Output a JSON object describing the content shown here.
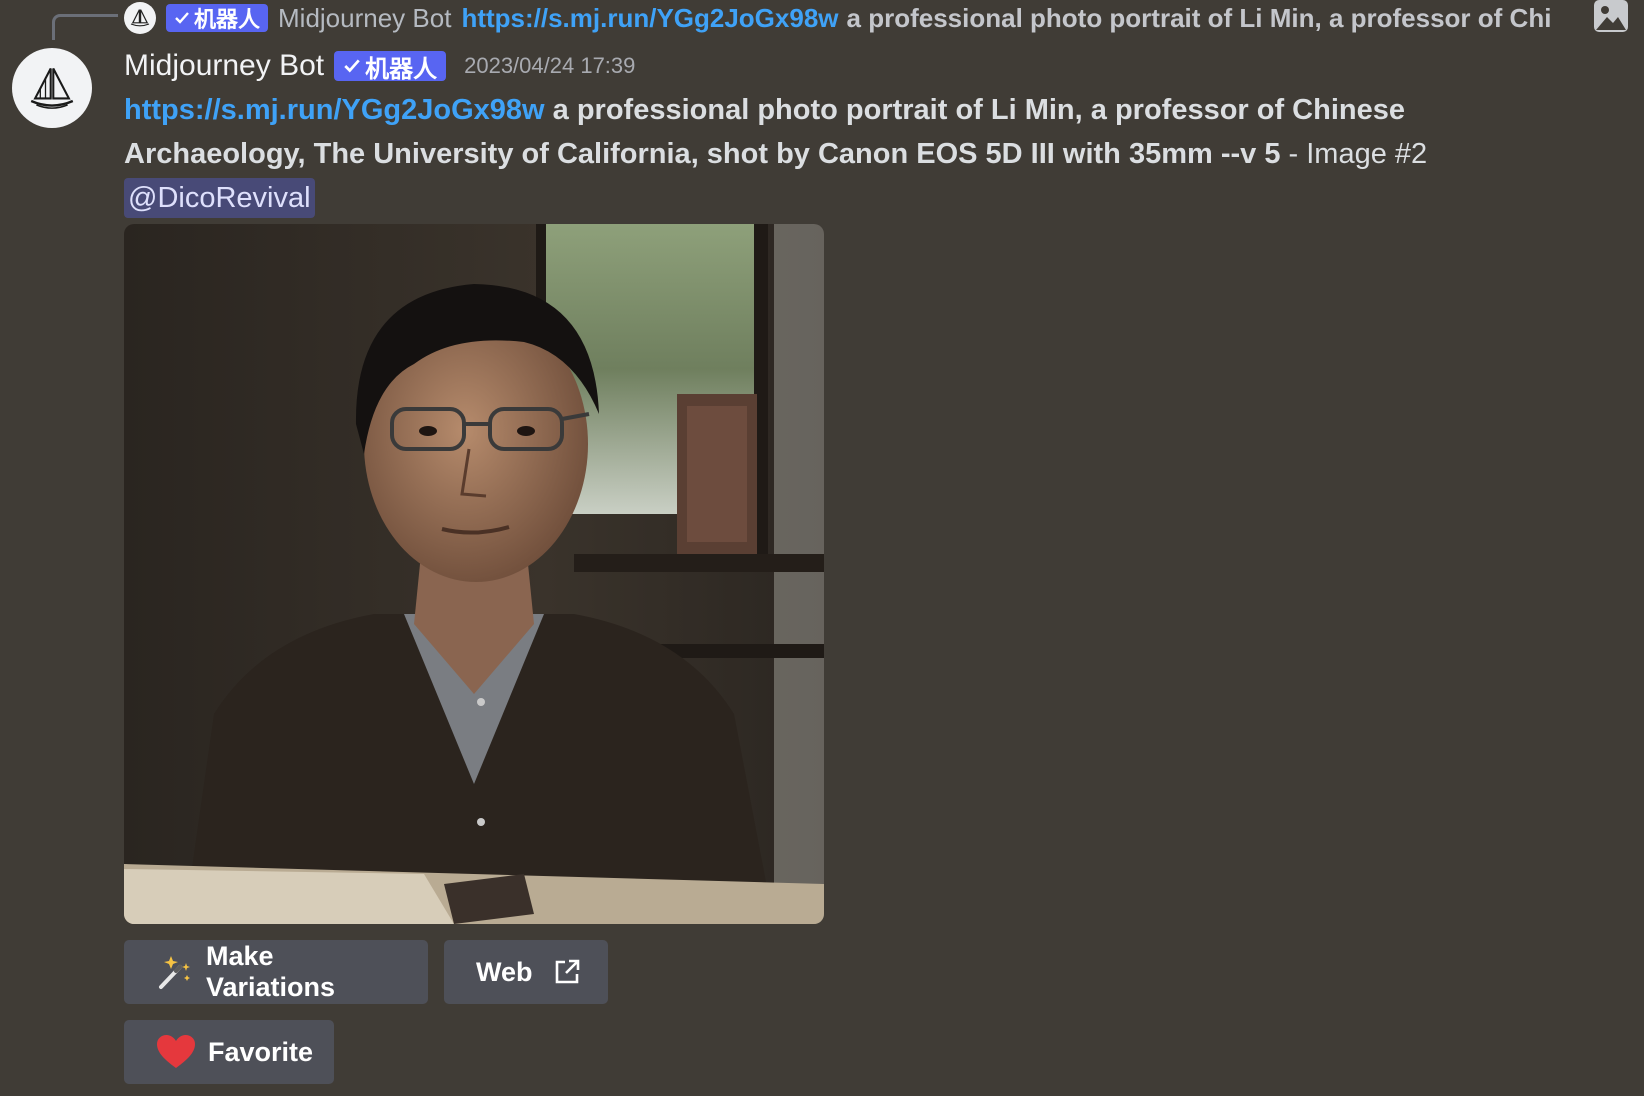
{
  "reply": {
    "author": "Midjourney Bot",
    "bot_tag": "机器人",
    "link": "https://s.mj.run/YGg2JoGx98w",
    "text_truncated": "a professional photo portrait of Li Min, a professor of Chi",
    "image_icon": "image-icon"
  },
  "message": {
    "author": "Midjourney Bot",
    "bot_tag": "机器人",
    "timestamp": "2023/04/24 17:39",
    "link": "https://s.mj.run/YGg2JoGx98w",
    "prompt": "a professional photo portrait of Li Min, a professor of Chinese Archaeology, The University of California, shot by Canon EOS 5D III with 35mm --v 5",
    "suffix": "- Image #2",
    "mention": "@DicoRevival",
    "avatar_icon": "sailboat-icon"
  },
  "attachment": {
    "description": "AI-generated portrait photo",
    "image_icon": "portrait-image"
  },
  "buttons": {
    "make_variations": "Make Variations",
    "web": "Web",
    "favorite": "Favorite"
  },
  "colors": {
    "background": "#403c36",
    "link": "#3fa2f7",
    "bot_tag": "#5865f2",
    "button": "#4e5058",
    "heart": "#e5383d"
  }
}
